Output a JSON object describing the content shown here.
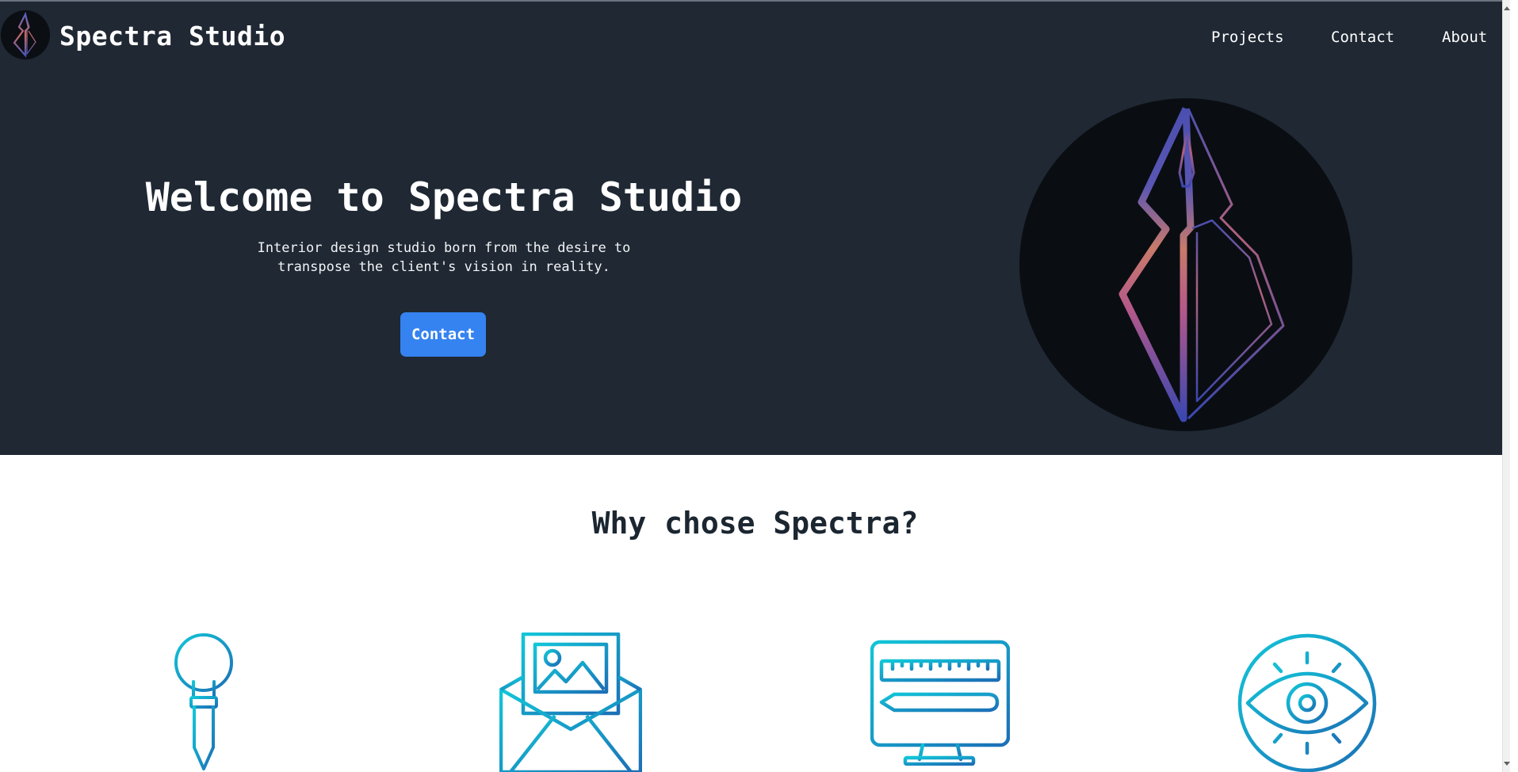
{
  "brand": {
    "title": "Spectra Studio"
  },
  "nav": {
    "links": [
      "Projects",
      "Contact",
      "About"
    ]
  },
  "hero": {
    "title": "Welcome to Spectra Studio",
    "subtitle": "Interior design studio born from the desire to transpose the client's vision in reality.",
    "cta_label": "Contact"
  },
  "features": {
    "title": "Why chose Spectra?",
    "icons": [
      "lightbulb-pencil-icon",
      "envelope-picture-icon",
      "monitor-ruler-pencil-icon",
      "eye-icon"
    ]
  },
  "colors": {
    "hero_bg": "#1f2833",
    "accent_button": "#3583f0",
    "icon_cyan": "#12c6d8",
    "icon_blue": "#1c6fb6",
    "emblem_purple": "#4a4fb0",
    "emblem_pink": "#c0607a"
  }
}
